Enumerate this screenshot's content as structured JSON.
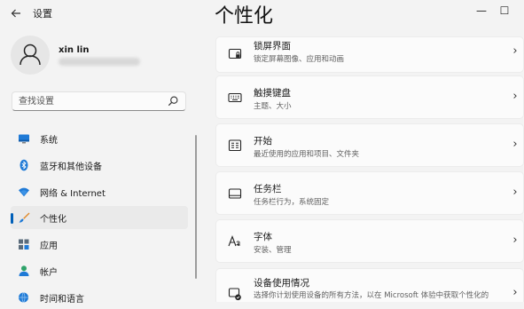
{
  "window": {
    "title": "设置",
    "back_icon": "arrow-left-icon",
    "minimize_glyph": "—",
    "maximize_glyph": "☐"
  },
  "page": {
    "title": "个性化"
  },
  "user": {
    "name": "xin lin"
  },
  "search": {
    "placeholder": "查找设置",
    "icon": "search-icon"
  },
  "sidebar": {
    "items": [
      {
        "label": "系统",
        "icon": "monitor-icon",
        "selected": false
      },
      {
        "label": "蓝牙和其他设备",
        "icon": "bluetooth-icon",
        "selected": false
      },
      {
        "label": "网络 & Internet",
        "icon": "wifi-icon",
        "selected": false
      },
      {
        "label": "个性化",
        "icon": "brush-icon",
        "selected": true
      },
      {
        "label": "应用",
        "icon": "apps-icon",
        "selected": false
      },
      {
        "label": "帐户",
        "icon": "person-icon",
        "selected": false
      },
      {
        "label": "时间和语言",
        "icon": "globe-clock-icon",
        "selected": false
      }
    ]
  },
  "cards": [
    {
      "title": "锁屏界面",
      "subtitle": "锁定屏幕图像、应用和动画",
      "icon": "lock-screen-icon"
    },
    {
      "title": "触摸键盘",
      "subtitle": "主题、大小",
      "icon": "keyboard-icon"
    },
    {
      "title": "开始",
      "subtitle": "最近使用的应用和项目、文件夹",
      "icon": "start-icon"
    },
    {
      "title": "任务栏",
      "subtitle": "任务栏行为，系统固定",
      "icon": "taskbar-icon"
    },
    {
      "title": "字体",
      "subtitle": "安装、管理",
      "icon": "font-icon"
    },
    {
      "title": "设备使用情况",
      "subtitle": "选择你计划使用设备的所有方法，以在 Microsoft 体验中获取个性化的",
      "icon": "device-usage-icon"
    }
  ],
  "colors": {
    "accent": "#005fb8",
    "background": "#f3f3f3",
    "card": "#fbfbfb"
  }
}
